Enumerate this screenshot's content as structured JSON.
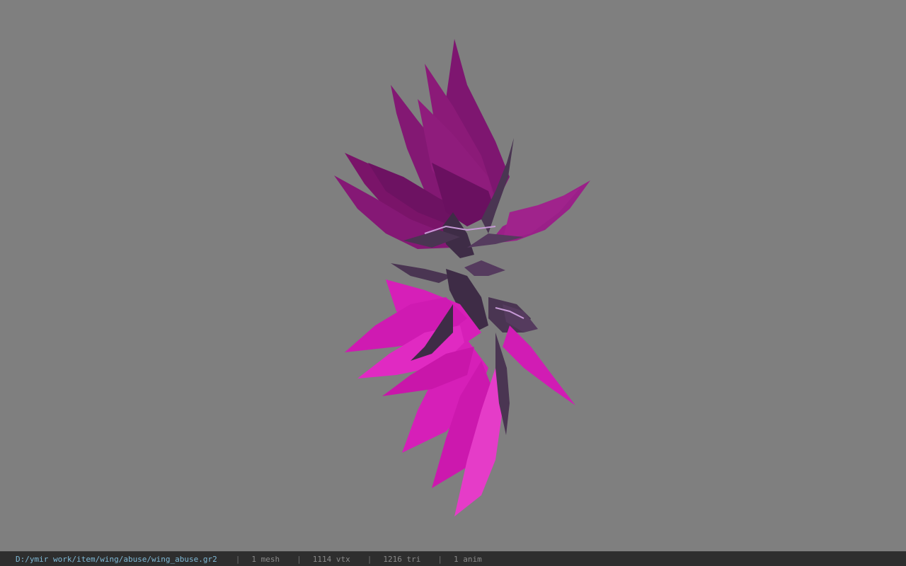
{
  "window": {
    "background_color": "#7f7f7f"
  },
  "viewport": {
    "model": "wing_abuse",
    "colors": {
      "upper_wing": "#8b1a78",
      "upper_wing_dark": "#6a1060",
      "lower_wing": "#d61fb8",
      "lower_wing_light": "#e53cc8",
      "armor": "#4a3552",
      "armor_highlight": "#c79ad6"
    }
  },
  "statusbar": {
    "file_path": "D:/ymir work/item/wing/abuse/wing_abuse.gr2",
    "separator": "|",
    "mesh_count": "1 mesh",
    "vertex_count": "1114 vtx",
    "triangle_count": "1216 tri",
    "anim_count": "1 anim"
  }
}
